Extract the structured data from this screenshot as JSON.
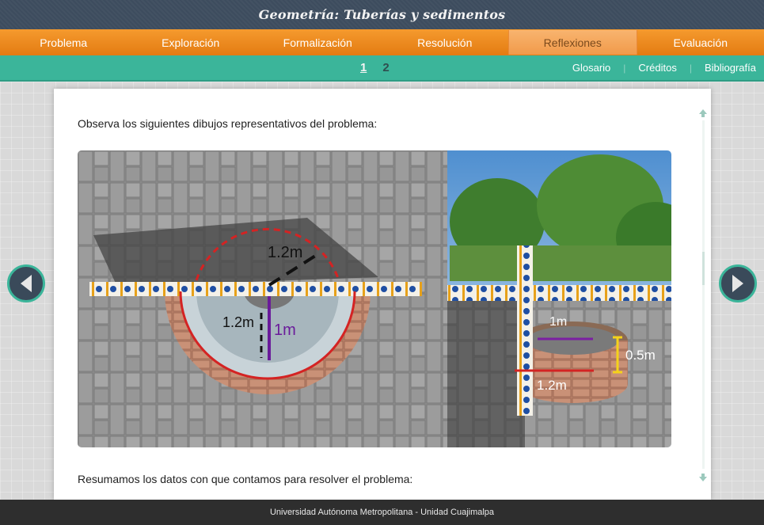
{
  "app": {
    "title": "Geometría: Tuberías y sedimentos"
  },
  "nav": {
    "tabs": [
      {
        "label": "Problema"
      },
      {
        "label": "Exploración"
      },
      {
        "label": "Formalización"
      },
      {
        "label": "Resolución"
      },
      {
        "label": "Reflexiones"
      },
      {
        "label": "Evaluación"
      }
    ],
    "active_tab": "Reflexiones"
  },
  "subnav": {
    "pages": [
      "1",
      "2"
    ],
    "current_page": "1",
    "links": [
      "Glosario",
      "Créditos",
      "Bibliografía"
    ]
  },
  "content": {
    "intro_text": "Observa los siguientes dibujos representativos del problema:",
    "summary_text": "Resumamos los datos con que contamos para resolver el problema:",
    "figure_left": {
      "labels": {
        "outer_radius": "1.2m",
        "inner_radius": "1.2m",
        "depth": "1m"
      }
    },
    "figure_right": {
      "labels": {
        "radius": "1m",
        "height": "0.5m",
        "diameter_segment": "1.2m"
      }
    }
  },
  "footer": {
    "text": "Universidad Autónoma Metropolitana - Unidad Cuajimalpa"
  },
  "colors": {
    "title_bar": "#3d4c5e",
    "nav_orange": "#f08a1d",
    "sub_teal": "#3bb59a",
    "footer": "#2e2e2e",
    "accent_red": "#d42323",
    "accent_purple": "#7b1fa2",
    "accent_yellow": "#f5d21a"
  },
  "icons": {
    "prev": "chevron-left-icon",
    "next": "chevron-right-icon",
    "scroll_up": "arrow-up-icon",
    "scroll_down": "arrow-down-icon"
  }
}
